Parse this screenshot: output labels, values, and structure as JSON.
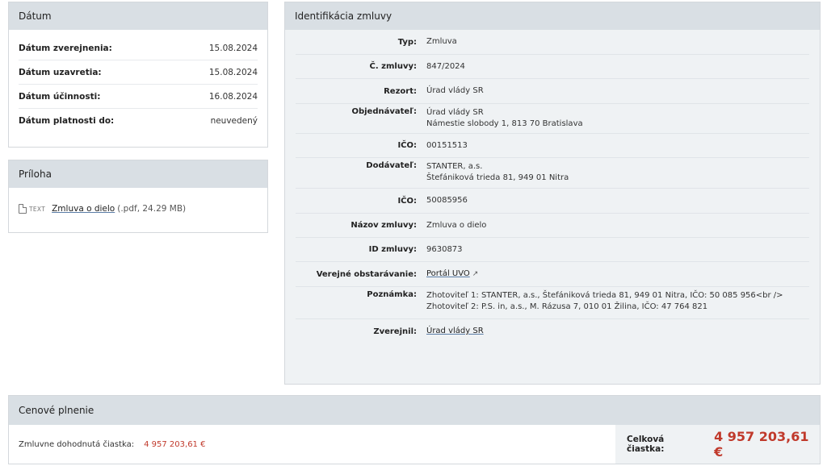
{
  "datum": {
    "title": "Dátum",
    "rows": [
      {
        "label": "Dátum zverejnenia:",
        "value": "15.08.2024"
      },
      {
        "label": "Dátum uzavretia:",
        "value": "15.08.2024"
      },
      {
        "label": "Dátum účinnosti:",
        "value": "16.08.2024"
      },
      {
        "label": "Dátum platnosti do:",
        "value": "neuvedený"
      }
    ]
  },
  "priloha": {
    "title": "Príloha",
    "file_type": "TEXT",
    "file_link": "Zmluva o dielo",
    "file_meta": "(.pdf, 24.29 MB)"
  },
  "ident": {
    "title": "Identifikácia zmluvy",
    "rows": [
      {
        "label": "Typ:",
        "lines": [
          "Zmluva"
        ]
      },
      {
        "label": "Č. zmluvy:",
        "lines": [
          "847/2024"
        ]
      },
      {
        "label": "Rezort:",
        "lines": [
          "Úrad vlády SR"
        ]
      },
      {
        "label": "Objednávateľ:",
        "lines": [
          "Úrad vlády SR",
          "Námestie slobody 1, 813 70 Bratislava"
        ]
      },
      {
        "label": "IČO:",
        "lines": [
          "00151513"
        ]
      },
      {
        "label": "Dodávateľ:",
        "lines": [
          "STANTER, a.s.",
          "Štefániková trieda 81, 949 01 Nitra"
        ]
      },
      {
        "label": "IČO:",
        "lines": [
          "50085956"
        ]
      },
      {
        "label": "Názov zmluvy:",
        "lines": [
          "Zmluva o dielo"
        ]
      },
      {
        "label": "ID zmluvy:",
        "lines": [
          "9630873"
        ]
      },
      {
        "label": "Verejné obstarávanie:",
        "link": "Portál UVO"
      },
      {
        "label": "Poznámka:",
        "lines": [
          "Zhotoviteľ 1: STANTER, a.s., Štefániková trieda 81, 949 01 Nitra, IČO: 50 085 956<br />",
          "Zhotoviteľ 2: P.S. in, a.s., M. Rázusa 7, 010 01 Žilina, IČO: 47 764 821"
        ]
      },
      {
        "label": "Zverejnil:",
        "link": "Úrad vlády SR"
      }
    ]
  },
  "cena": {
    "title": "Cenové plnenie",
    "agreed_label": "Zmluvne dohodnutá čiastka:",
    "agreed_value": "4 957 203,61 €",
    "total_label": "Celková čiastka:",
    "total_value": "4 957 203,61 €",
    "amount_color": "#c0392b"
  }
}
